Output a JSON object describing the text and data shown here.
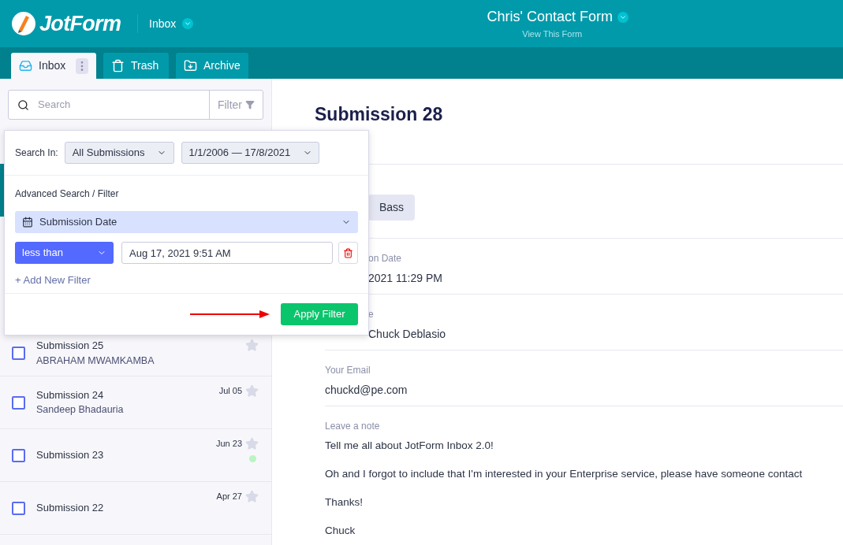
{
  "header": {
    "logo": "JotForm",
    "section": "Inbox",
    "form_title": "Chris' Contact Form",
    "form_link": "View This Form"
  },
  "tabs": [
    {
      "label": "Inbox",
      "selected": true
    },
    {
      "label": "Trash",
      "selected": false
    },
    {
      "label": "Archive",
      "selected": false
    }
  ],
  "search": {
    "placeholder": "Search",
    "filter_button": "Filter"
  },
  "filter_panel": {
    "search_in_label": "Search In:",
    "scope": "All Submissions",
    "date_range": "1/1/2006 — 17/8/2021",
    "advanced_title": "Advanced Search / Filter",
    "field": "Submission Date",
    "operator": "less than",
    "value": "Aug 17, 2021 9:51 AM",
    "add_filter": "+ Add New Filter",
    "apply_button": "Apply Filter"
  },
  "submissions": [
    {
      "title": "Submission 25",
      "name": "ABRAHAM MWAMKAMBA",
      "checked": false,
      "new": false
    },
    {
      "title": "Submission 24",
      "name": "Sandeep Bhadauria",
      "date": "Jul 05",
      "checked": false,
      "new": false
    },
    {
      "title": "Submission 23",
      "date": "Jun 23",
      "checked": false,
      "new": true
    },
    {
      "title": "Submission 22",
      "date": "Apr 27",
      "checked": false,
      "new": false
    }
  ],
  "detail": {
    "title": "Submission 28",
    "fields": [
      {
        "kind": "chip",
        "covered": true,
        "value": "Bass"
      },
      {
        "kind": "text",
        "covered": true,
        "label": "on Date",
        "value": "2021 11:29 PM"
      },
      {
        "kind": "text",
        "covered": true,
        "label": "e",
        "value": "Chuck Deblasio"
      },
      {
        "kind": "text",
        "covered": false,
        "label": "Your Email",
        "value": "chuckd@pe.com"
      },
      {
        "kind": "note",
        "covered": false,
        "label": "Leave a note",
        "paragraphs": [
          "Tell me all about JotForm Inbox 2.0!",
          "Oh and I forgot to include that I'm interested in your Enterprise service, please have someone contact",
          "Thanks!",
          "Chuck"
        ]
      }
    ]
  }
}
